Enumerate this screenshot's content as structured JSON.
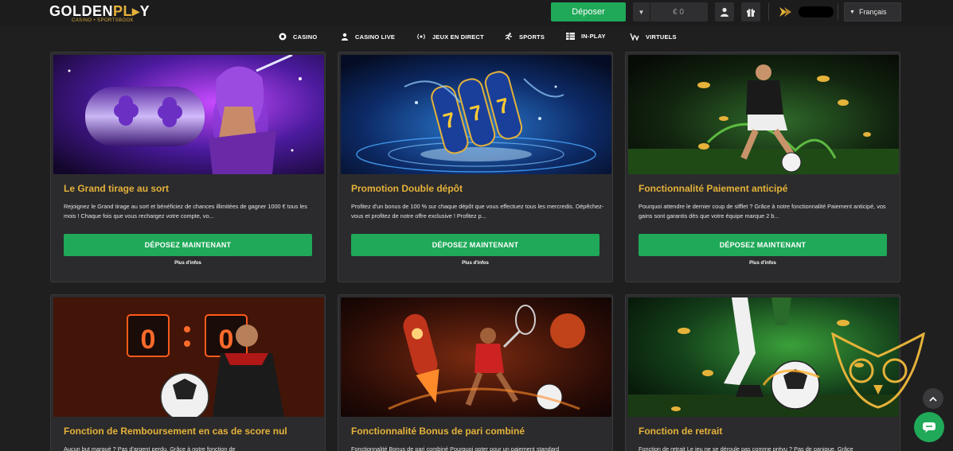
{
  "header": {
    "logo_prefix": "GOLDEN",
    "logo_suffix": "PL",
    "logo_end": "Y",
    "logo_sub": "CASINO • SPORTSBOOK",
    "deposit_label": "Déposer",
    "balance": "€ 0",
    "language": "Français"
  },
  "nav": {
    "items": [
      {
        "label": "CASINO",
        "icon": "casino-chip-icon"
      },
      {
        "label": "CASINO LIVE",
        "icon": "dealer-icon"
      },
      {
        "label": "JEUX EN DIRECT",
        "icon": "broadcast-icon"
      },
      {
        "label": "SPORTS",
        "icon": "running-icon"
      },
      {
        "label": "IN-PLAY",
        "icon": "grid-icon"
      },
      {
        "label": "VIRTUELS",
        "icon": "virtual-icon"
      }
    ]
  },
  "cards": [
    {
      "title": "Le Grand tirage au sort",
      "desc": "Rejoignez le Grand tirage au sort et bénéficiez de chances illimitées de gagner 1000 € tous les mois ! Chaque fois que vous rechargez votre compte, vo...",
      "button": "DÉPOSEZ MAINTENANT",
      "more": "Plus d'infos"
    },
    {
      "title": "Promotion Double dépôt",
      "desc": "Profitez d'un bonus de 100 % sur chaque dépôt que vous effectuez tous les mercredis. Dépêchez-vous et profitez de notre offre exclusive ! Profitez p...",
      "button": "DÉPOSEZ MAINTENANT",
      "more": "Plus d'infos"
    },
    {
      "title": "Fonctionnalité Paiement anticipé",
      "desc": "Pourquoi attendre le dernier coup de sifflet ? Grâce à notre fonctionnalité Paiement anticipé, vos gains sont garantis dès que votre équipe marque 2 b...",
      "button": "DÉPOSEZ MAINTENANT",
      "more": "Plus d'infos"
    },
    {
      "title": "Fonction de Remboursement en cas de score nul",
      "desc": "Aucun but marqué ? Pas d'argent perdu. Grâce à notre fonction de",
      "scoreboard": "0 : 0"
    },
    {
      "title": "Fonctionnalité Bonus de pari combiné",
      "desc": "Fonctionnalité Bonus de pari combiné Pourquoi opter pour un paiement standard"
    },
    {
      "title": "Fonction de retrait",
      "desc": "Fonction de retrait Le jeu ne se déroule pas comme prévu ? Pas de panique. Grâce"
    }
  ],
  "colors": {
    "accent_green": "#1fa958",
    "title_gold": "#e5b23a",
    "background": "#1f1f20",
    "card_bg": "#2b2b2d"
  }
}
